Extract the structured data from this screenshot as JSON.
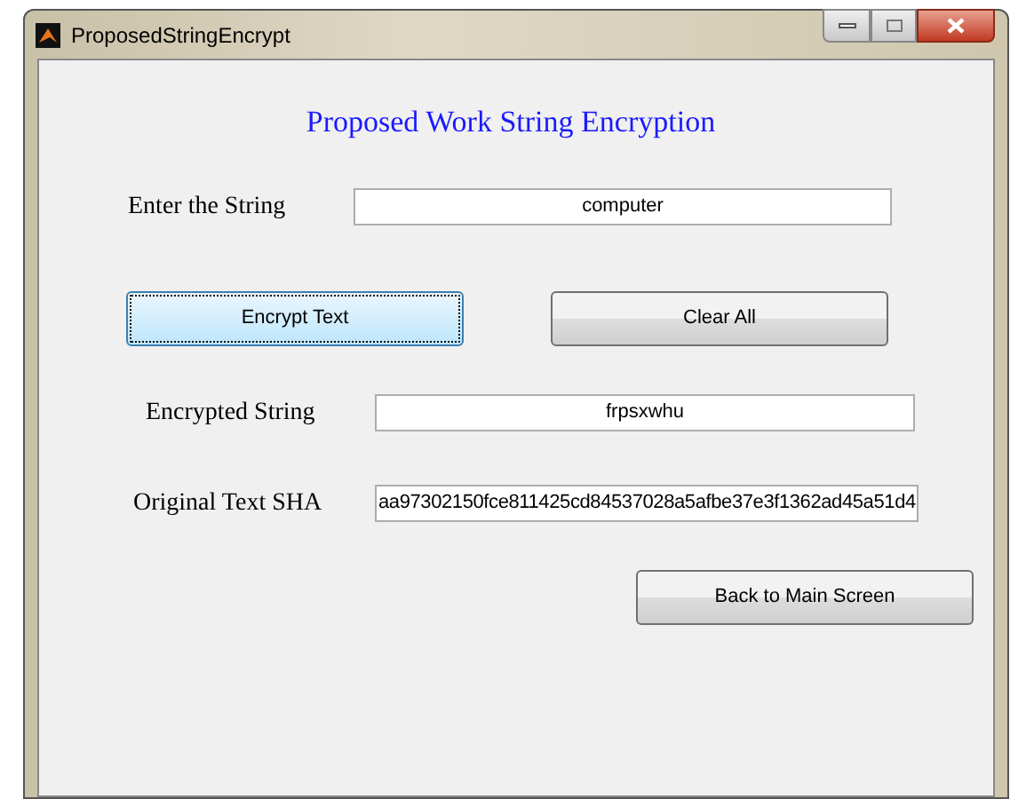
{
  "window": {
    "title": "ProposedStringEncrypt"
  },
  "heading": "Proposed Work String Encryption",
  "input": {
    "label": "Enter the String",
    "value": "computer"
  },
  "buttons": [
    {
      "label": "Encrypt Text",
      "focused": true
    },
    {
      "label": "Clear All",
      "focused": false
    }
  ],
  "encrypted": {
    "label": "Encrypted String",
    "value": "frpsxwhu"
  },
  "sha": {
    "label": "Original Text SHA",
    "value": "aa97302150fce811425cd84537028a5afbe37e3f1362ad45a51d4"
  },
  "back_button": {
    "label": "Back to Main Screen",
    "focused": false
  }
}
